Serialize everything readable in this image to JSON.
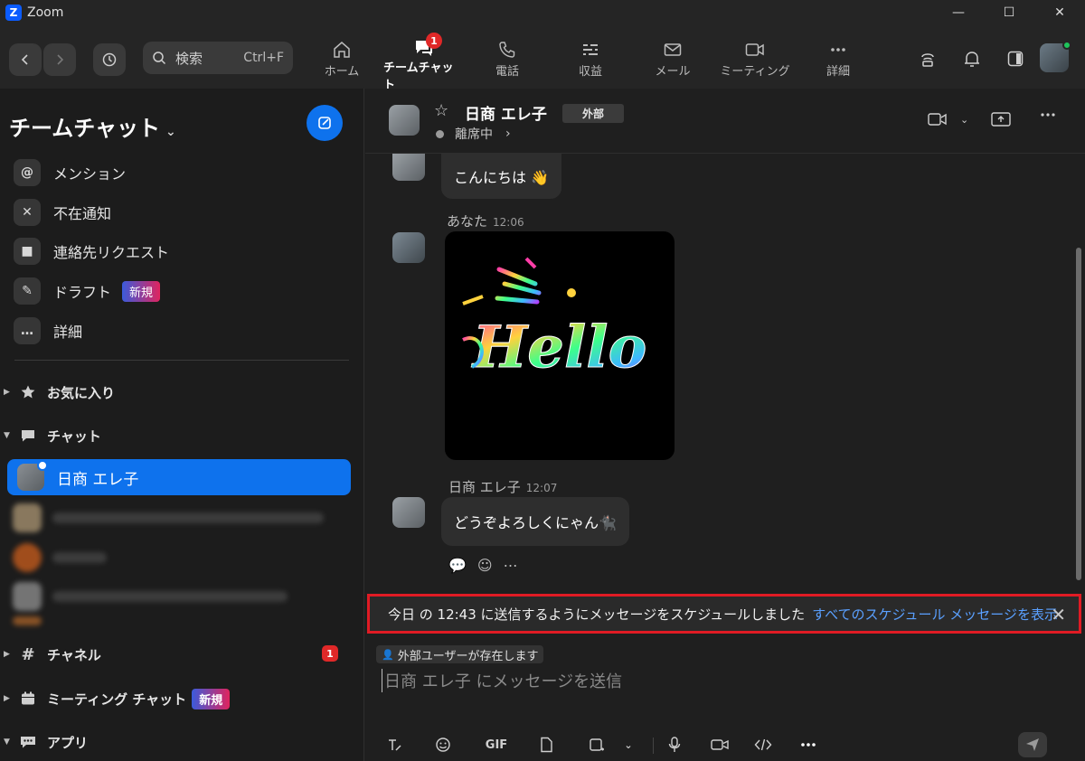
{
  "app": {
    "title": "Zoom",
    "logo_letter": "Z"
  },
  "window": {
    "minimize": "—",
    "maximize": "☐",
    "close": "✕"
  },
  "search": {
    "placeholder": "検索",
    "shortcut": "Ctrl+F"
  },
  "nav": {
    "tabs": [
      {
        "label": "ホーム",
        "icon": "home-icon"
      },
      {
        "label": "チームチャット",
        "icon": "chat-icon",
        "badge": "1",
        "active": true
      },
      {
        "label": "電話",
        "icon": "phone-icon"
      },
      {
        "label": "収益",
        "icon": "revenue-icon"
      },
      {
        "label": "メール",
        "icon": "mail-icon"
      },
      {
        "label": "ミーティング",
        "icon": "video-icon"
      },
      {
        "label": "詳細",
        "icon": "more-icon"
      }
    ]
  },
  "sidebar": {
    "title": "チームチャット",
    "items": [
      {
        "label": "メンション",
        "icon": "at-icon",
        "glyph": "@"
      },
      {
        "label": "不在通知",
        "icon": "video-off-icon",
        "glyph": "✕"
      },
      {
        "label": "連絡先リクエスト",
        "icon": "contact-icon",
        "glyph": "■"
      },
      {
        "label": "ドラフト",
        "icon": "draft-icon",
        "glyph": "✎",
        "badge": "新規"
      },
      {
        "label": "詳細",
        "icon": "more-icon",
        "glyph": "…"
      }
    ],
    "sections": {
      "favorites": "お気に入り",
      "chat": "チャット",
      "channels": "チャネル",
      "channels_badge": "1",
      "meeting_chat": "ミーティング チャット",
      "meeting_chat_badge": "新規",
      "apps": "アプリ"
    },
    "active_chat": "日商 エレ子"
  },
  "chat": {
    "contact_name": "日商 エレ子",
    "tag": "外部",
    "status": "離席中",
    "messages": [
      {
        "text": "こんにちは 👋"
      },
      {
        "sender": "あなた",
        "time": "12:06",
        "image_text": "Hello"
      },
      {
        "sender": "日商 エレ子",
        "time": "12:07",
        "text": "どうぞよろしくにゃん🐈‍⬛"
      }
    ],
    "schedule_notice": "今日 の 12:43 に送信するようにメッセージをスケジュールしました",
    "schedule_link": "すべてのスケジュール メッセージを表示",
    "external_notice": "外部ユーザーが存在します",
    "input_placeholder": "日商 エレ子 にメッセージを送信",
    "toolbar_gif": "GIF"
  },
  "colors": {
    "accent": "#0e72ed",
    "badge": "#e02828",
    "highlight_border": "#e01b24",
    "link": "#5aa0ff"
  }
}
